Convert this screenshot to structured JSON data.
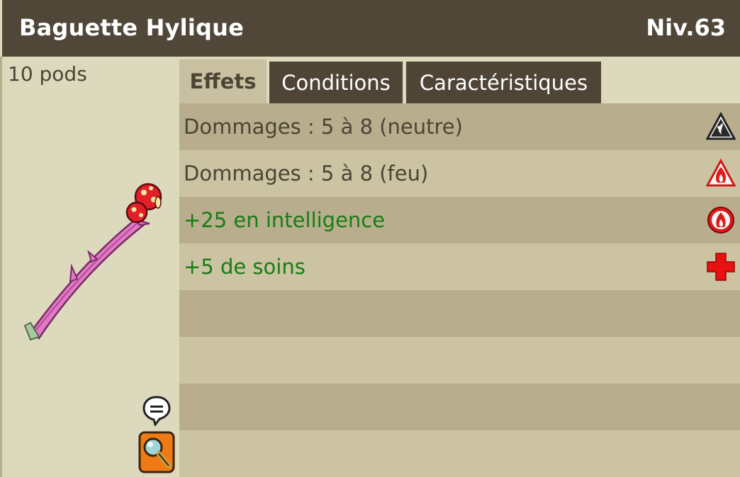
{
  "item": {
    "name": "Baguette Hylique",
    "level": "Niv.63",
    "weight": "10 pods"
  },
  "tabs": [
    {
      "label": "Effets",
      "active": true
    },
    {
      "label": "Conditions",
      "active": false
    },
    {
      "label": "Caractéristiques",
      "active": false
    }
  ],
  "effects": [
    {
      "text": "Dommages : 5 à 8 (neutre)",
      "color": "gray",
      "icon": "neutral-element-icon"
    },
    {
      "text": "Dommages : 5 à 8 (feu)",
      "color": "gray",
      "icon": "fire-element-icon"
    },
    {
      "text": "+25 en intelligence",
      "color": "green",
      "icon": "intelligence-icon"
    },
    {
      "text": "+5 de soins",
      "color": "green",
      "icon": "heal-cross-icon"
    }
  ],
  "colors": {
    "titlebar": "#514739",
    "panel": "#ddd9bd",
    "row_dark": "#b8ae8d",
    "row_light": "#cbc3a1",
    "bonus_green": "#197c14",
    "text_gray": "#4c4434"
  }
}
